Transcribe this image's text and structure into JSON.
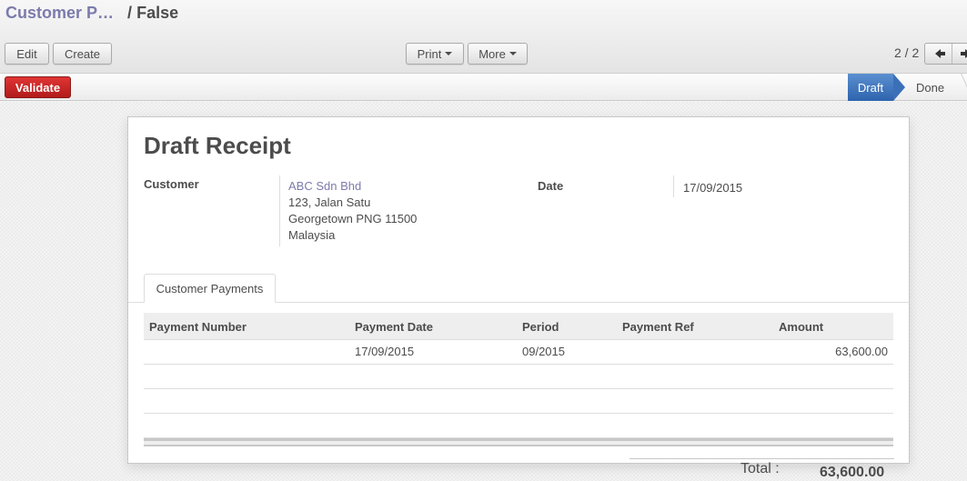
{
  "breadcrumb": {
    "parent": "Customer P…",
    "separator": "/",
    "current": "False"
  },
  "toolbar": {
    "edit_label": "Edit",
    "create_label": "Create",
    "print_label": "Print",
    "more_label": "More",
    "pager": "2 / 2"
  },
  "statusbar": {
    "validate_label": "Validate",
    "stages": [
      {
        "label": "Draft",
        "active": true
      },
      {
        "label": "Done",
        "active": false
      }
    ],
    "colors": {
      "validate": "#c62828",
      "active_stage": "#3a70b8"
    }
  },
  "form": {
    "title": "Draft Receipt",
    "customer_label": "Customer",
    "customer": {
      "name": "ABC Sdn Bhd",
      "address_line1": "123, Jalan Satu",
      "address_line2": "Georgetown PNG 11500",
      "country": "Malaysia"
    },
    "date_label": "Date",
    "date_value": "17/09/2015",
    "tabs": [
      {
        "label": "Customer Payments"
      }
    ],
    "table": {
      "columns": [
        "Payment Number",
        "Payment Date",
        "Period",
        "Payment Ref",
        "Amount"
      ],
      "rows": [
        {
          "payment_number": "",
          "payment_date": "17/09/2015",
          "period": "09/2015",
          "payment_ref": "",
          "amount": "63,600.00"
        }
      ]
    },
    "total_label": "Total :",
    "total_value": "63,600.00"
  }
}
